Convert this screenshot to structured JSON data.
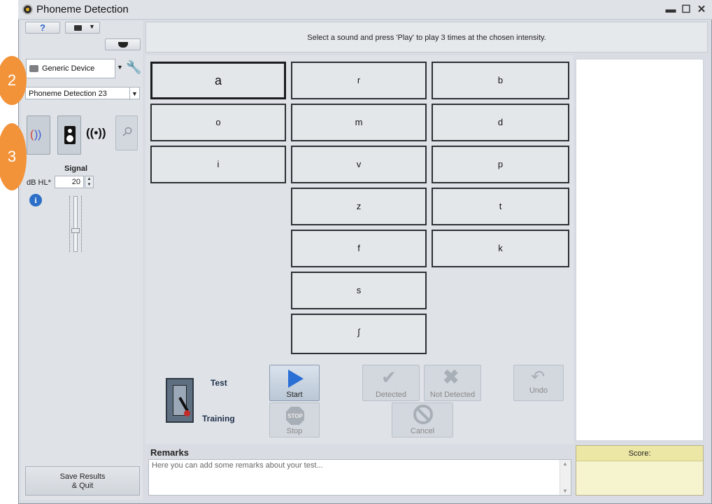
{
  "window": {
    "title": "Phoneme Detection"
  },
  "left": {
    "device": "Generic Device",
    "test_select": "Phoneme Detection 23",
    "callouts": [
      "2",
      "3"
    ],
    "signal_title": "Signal",
    "db_label": "dB HL*",
    "db_value": "20",
    "save_label": "Save Results\n& Quit"
  },
  "message": "Select a sound and press 'Play' to play 3 times at the chosen intensity.",
  "phonemes": {
    "col1": [
      "a",
      "o",
      "i"
    ],
    "col2": [
      "r",
      "m",
      "v",
      "z",
      "f",
      "s",
      "ʃ"
    ],
    "col3": [
      "b",
      "d",
      "p",
      "t",
      "k"
    ]
  },
  "mode": {
    "test": "Test",
    "training": "Training"
  },
  "controls": {
    "start": "Start",
    "stop": "Stop",
    "detected": "Detected",
    "not_detected": "Not Detected",
    "cancel": "Cancel",
    "undo": "Undo"
  },
  "remarks": {
    "label": "Remarks",
    "placeholder": "Here you can add some remarks about your test..."
  },
  "score": {
    "label": "Score:"
  },
  "colors": {
    "callout": "#f2933a",
    "play": "#2a6fd6",
    "score_bg": "#f6f3cf"
  }
}
